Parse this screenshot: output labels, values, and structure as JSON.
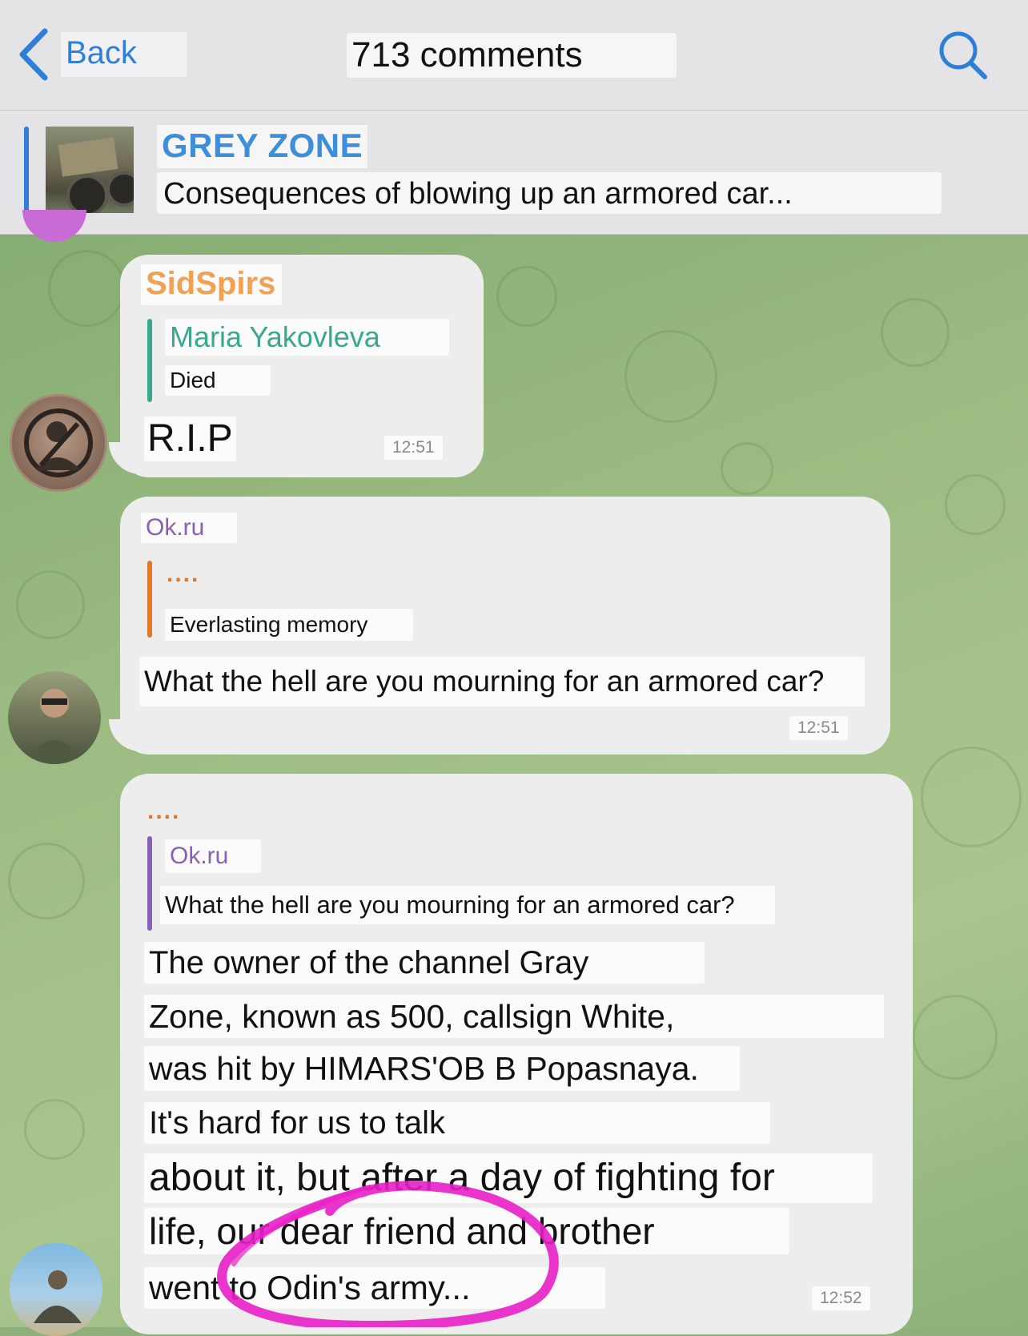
{
  "nav": {
    "back_label": "Back",
    "title": "713 comments"
  },
  "pinned": {
    "channel": "GREY ZONE",
    "text": "Consequences of blowing up an armored car..."
  },
  "messages": [
    {
      "sender": "SidSpirs",
      "reply_author": "Maria Yakovleva",
      "reply_text": "Died",
      "text": "R.I.P",
      "time": "12:51"
    },
    {
      "sender": "Ok.ru",
      "reply_author": "....",
      "reply_text": "Everlasting memory",
      "text": "What the hell are you mourning for an armored car?",
      "time": "12:51"
    },
    {
      "sender": "....",
      "reply_author": "Ok.ru",
      "reply_text": "What the hell are you mourning for an armored car?",
      "lines": [
        "The owner of the channel Gray",
        "Zone, known as 500, callsign White,",
        "was hit by HIMARS'OB B Popasnaya.",
        "It's hard for us to talk",
        "about it, but after a day of fighting for",
        "life, our dear friend and brother",
        "went to Odin's army..."
      ],
      "time": "12:52"
    }
  ],
  "colors": {
    "accent": "#2f7fd8",
    "sidspirs": "#f0a154",
    "maria": "#3aa88f",
    "okru": "#8a5fb8",
    "dots": "#e0782a",
    "annotation": "#e81fc6"
  }
}
